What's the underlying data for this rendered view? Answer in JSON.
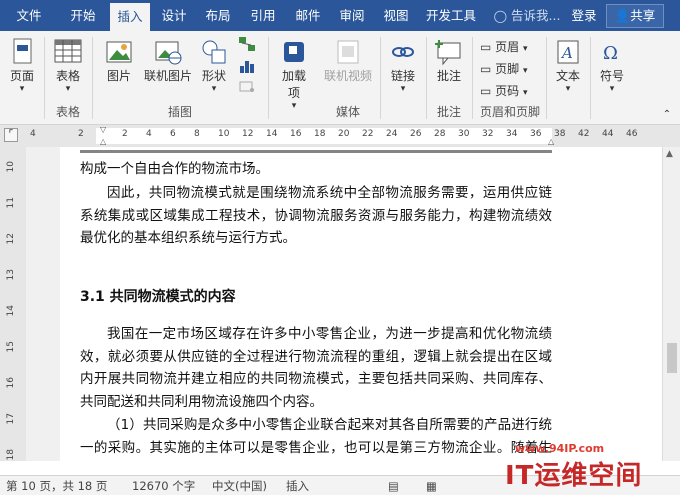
{
  "tabs": [
    {
      "label": "文件"
    },
    {
      "label": "开始"
    },
    {
      "label": "插入"
    },
    {
      "label": "设计"
    },
    {
      "label": "布局"
    },
    {
      "label": "引用"
    },
    {
      "label": "邮件"
    },
    {
      "label": "审阅"
    },
    {
      "label": "视图"
    },
    {
      "label": "开发工具"
    }
  ],
  "tell_me": "告诉我...",
  "login": "登录",
  "share": "共享",
  "ribbon": {
    "page": "页面",
    "table": "表格",
    "picture": "图片",
    "online_picture": "联机图片",
    "shapes": "形状",
    "addins": "加载\n项",
    "addins1": "加载",
    "addins2": "项",
    "online_video": "联机视频",
    "link": "链接",
    "comment": "批注",
    "header": "页眉",
    "footer": "页脚",
    "page_number": "页码",
    "text": "文本",
    "symbol": "符号"
  },
  "groups": {
    "table": "表格",
    "illustrations": "插图",
    "media": "媒体",
    "comments": "批注",
    "header_footer": "页眉和页脚"
  },
  "ruler_ticks": [
    "4",
    "2",
    "2",
    "4",
    "6",
    "8",
    "10",
    "12",
    "14",
    "16",
    "18",
    "20",
    "22",
    "24",
    "26",
    "28",
    "30",
    "32",
    "34",
    "36",
    "38",
    "42",
    "44",
    "46"
  ],
  "vruler_ticks": [
    "10",
    "11",
    "12",
    "13",
    "14",
    "15",
    "16",
    "17",
    "18"
  ],
  "document": {
    "line0": "构成一个自由合作的物流市场。",
    "para1": "因此，共同物流模式就是围绕物流系统中全部物流服务需要，运用供应链系统集成或区域集成工程技术，协调物流服务资源与服务能力，构建物流绩效最优化的基本组织系统与运行方式。",
    "heading": "3.1 共同物流模式的内容",
    "para2": "我国在一定市场区域存在许多中小零售企业，为进一步提高和优化物流绩效，就必须要从供应链的全过程进行物流流程的重组，逻辑上就会提出在区域内开展共同物流并建立相应的共同物流模式，主要包括共同采购、共同库存、共同配送和共同利用物流设施四个内容。",
    "para3": "（1）共同采购是众多中小零售企业联合起来对其各自所需要的产品进行统一的采购。其实施的主体可以是零售企业，也可以是第三方物流企业。随着生产"
  },
  "status": {
    "page": "第 10 页，共 18 页",
    "words": "12670 个字",
    "lang": "中文(中国)",
    "mode": "插入"
  },
  "watermark": {
    "url": "www.94IP.com",
    "brand": "IT运维空间"
  },
  "colors": {
    "accent": "#2b579a",
    "watermark": "#c62828"
  }
}
